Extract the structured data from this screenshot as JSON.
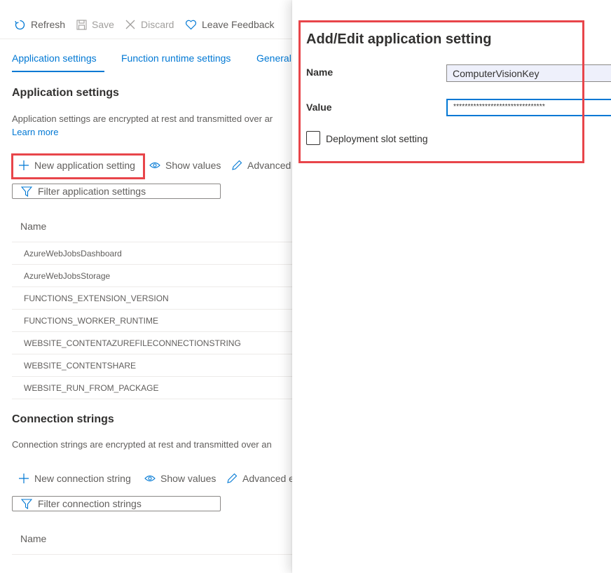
{
  "toolbar": {
    "refresh_label": "Refresh",
    "save_label": "Save",
    "discard_label": "Discard",
    "feedback_label": "Leave Feedback"
  },
  "tabs": [
    {
      "label": "Application settings",
      "active": true
    },
    {
      "label": "Function runtime settings",
      "active": false
    },
    {
      "label": "General",
      "active": false
    }
  ],
  "app_settings": {
    "title": "Application settings",
    "description": "Application settings are encrypted at rest and transmitted over ar",
    "learn_more": "Learn more",
    "new_button": "New application setting",
    "show_values": "Show values",
    "advanced": "Advanced",
    "filter_placeholder": "Filter application settings",
    "column_name": "Name",
    "rows": [
      "AzureWebJobsDashboard",
      "AzureWebJobsStorage",
      "FUNCTIONS_EXTENSION_VERSION",
      "FUNCTIONS_WORKER_RUNTIME",
      "WEBSITE_CONTENTAZUREFILECONNECTIONSTRING",
      "WEBSITE_CONTENTSHARE",
      "WEBSITE_RUN_FROM_PACKAGE"
    ]
  },
  "connection_strings": {
    "title": "Connection strings",
    "description": "Connection strings are encrypted at rest and transmitted over an",
    "new_button": "New connection string",
    "show_values": "Show values",
    "advanced": "Advanced e",
    "filter_placeholder": "Filter connection strings",
    "column_name": "Name"
  },
  "panel": {
    "title": "Add/Edit application setting",
    "name_label": "Name",
    "name_value": "ComputerVisionKey",
    "value_label": "Value",
    "value_value": "********************************",
    "slot_setting_label": "Deployment slot setting",
    "slot_setting_checked": false
  },
  "colors": {
    "accent": "#0078d4",
    "highlight_border": "#e8454a"
  }
}
